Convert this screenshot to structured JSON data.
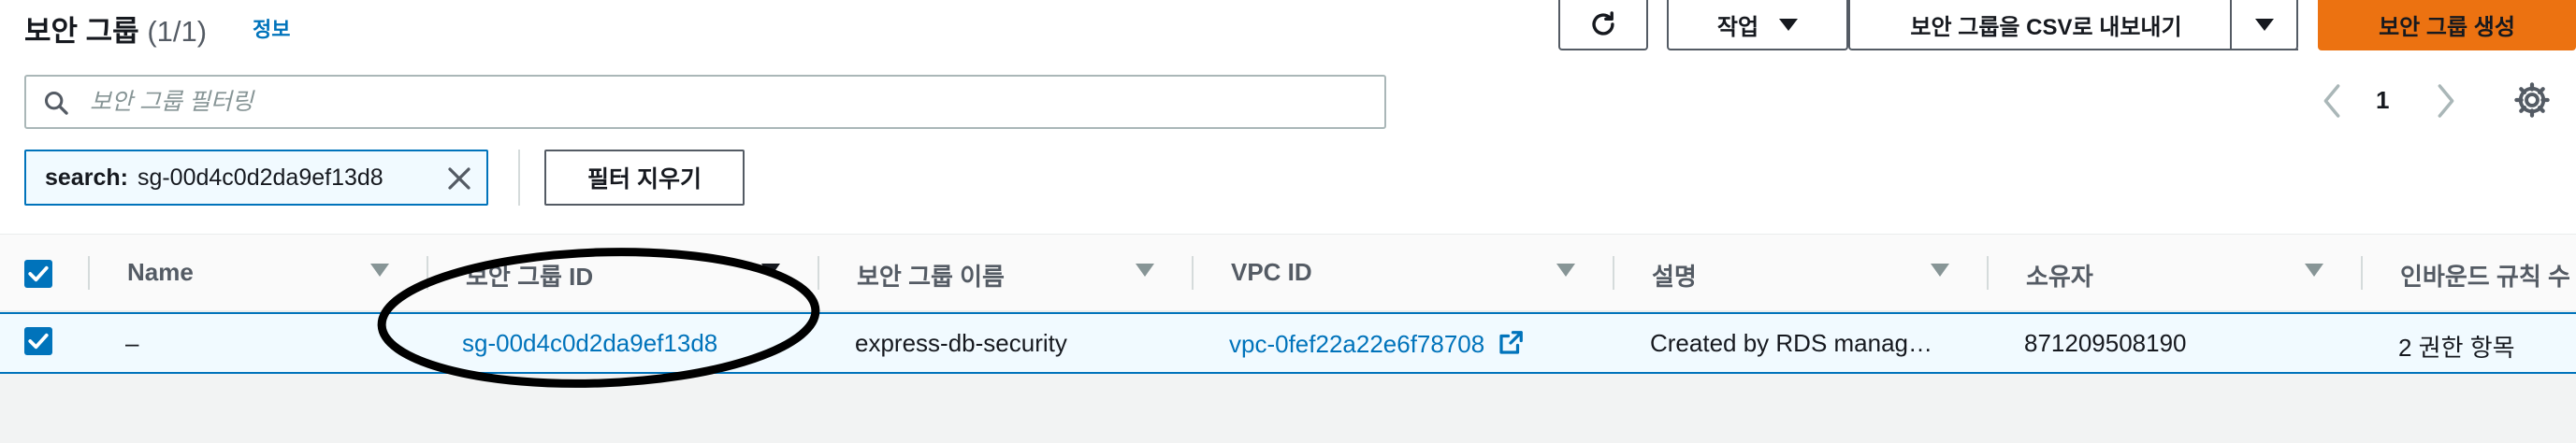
{
  "header": {
    "title": "보안 그룹",
    "count": "(1/1)",
    "info_link": "정보"
  },
  "toolbar": {
    "refresh_icon": "refresh-icon",
    "actions_label": "작업",
    "export_csv_label": "보안 그룹을 CSV로 내보내기",
    "create_label": "보안 그룹 생성"
  },
  "search": {
    "placeholder": "보안 그룹 필터링",
    "value": ""
  },
  "pagination": {
    "page": "1"
  },
  "filter": {
    "key": "search:",
    "value": "sg-00d4c0d2da9ef13d8",
    "clear_label": "필터 지우기"
  },
  "table": {
    "columns": [
      "Name",
      "보안 그룹 ID",
      "보안 그룹 이름",
      "VPC ID",
      "설명",
      "소유자",
      "인바운드 규칙 수"
    ],
    "rows": [
      {
        "selected": true,
        "name": "–",
        "sg_id": "sg-00d4c0d2da9ef13d8",
        "sg_name": "express-db-security",
        "vpc_id": "vpc-0fef22a22e6f78708",
        "description": "Created by RDS manag…",
        "owner": "871209508190",
        "inbound": "2 권한 항목"
      }
    ]
  },
  "colors": {
    "accent": "#0073bb",
    "primary_button": "#ec7211",
    "annotation": "#000000"
  }
}
